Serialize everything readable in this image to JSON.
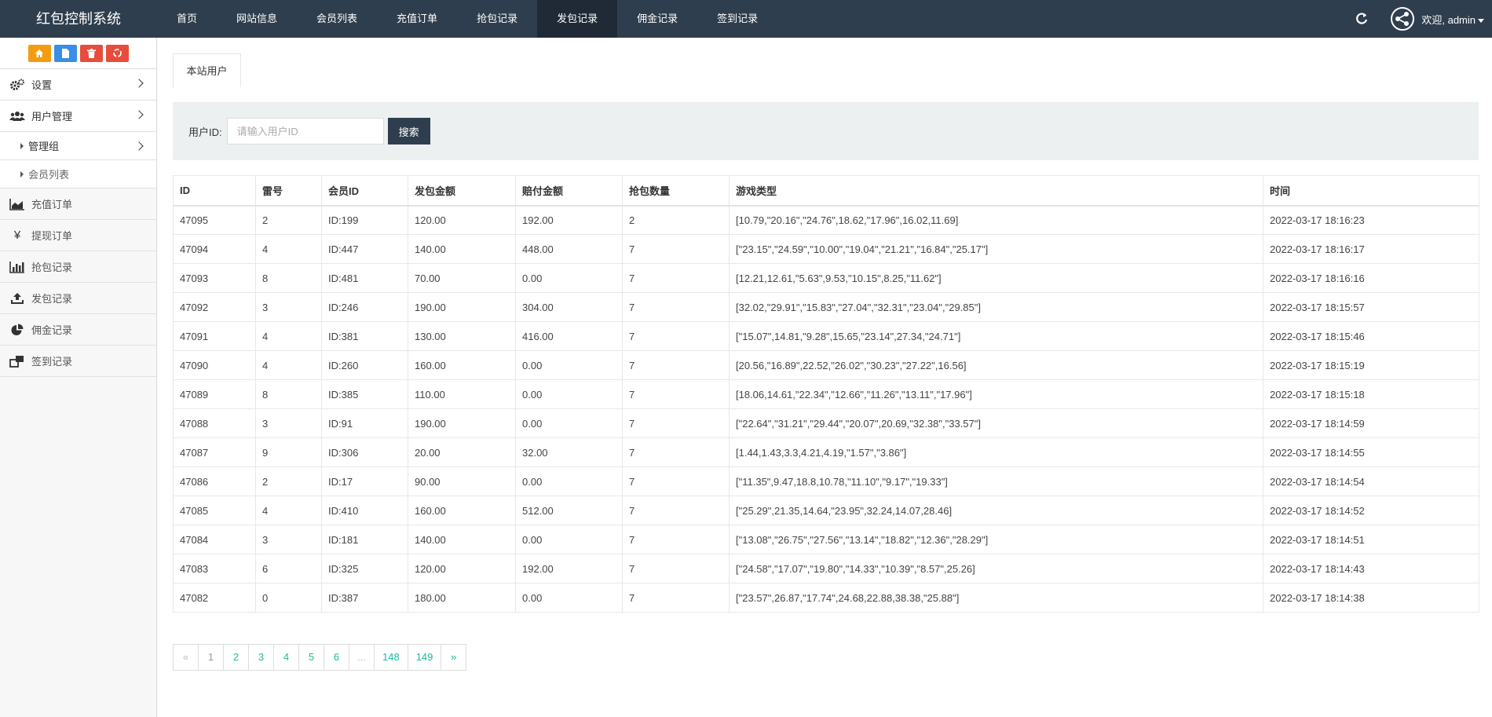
{
  "brand": "红包控制系统",
  "nav": [
    {
      "label": "首页",
      "active": false
    },
    {
      "label": "网站信息",
      "active": false
    },
    {
      "label": "会员列表",
      "active": false
    },
    {
      "label": "充值订单",
      "active": false
    },
    {
      "label": "抢包记录",
      "active": false
    },
    {
      "label": "发包记录",
      "active": true
    },
    {
      "label": "佣金记录",
      "active": false
    },
    {
      "label": "签到记录",
      "active": false
    }
  ],
  "user": {
    "welcome": "欢迎, admin"
  },
  "shortcuts": [
    "home-icon",
    "file-icon",
    "trash-icon",
    "recycle-icon"
  ],
  "sidebar": {
    "settings": "设置",
    "user_mgmt": "用户管理",
    "admin_group": "管理组",
    "member_list": "会员列表",
    "recharge": "充值订单",
    "withdraw": "提现订单",
    "grab": "抢包记录",
    "send": "发包记录",
    "commission": "佣金记录",
    "signin": "签到记录"
  },
  "tab": {
    "label": "本站用户"
  },
  "search": {
    "label": "用户ID:",
    "placeholder": "请输入用户ID",
    "button": "搜索"
  },
  "table": {
    "columns": [
      "ID",
      "雷号",
      "会员ID",
      "发包金额",
      "赔付金额",
      "抢包数量",
      "游戏类型",
      "时间"
    ],
    "rows": [
      [
        "47095",
        "2",
        "ID:199",
        "120.00",
        "192.00",
        "2",
        "[10.79,\"20.16\",\"24.76\",18.62,\"17.96\",16.02,11.69]",
        "2022-03-17 18:16:23"
      ],
      [
        "47094",
        "4",
        "ID:447",
        "140.00",
        "448.00",
        "7",
        "[\"23.15\",\"24.59\",\"10.00\",\"19.04\",\"21.21\",\"16.84\",\"25.17\"]",
        "2022-03-17 18:16:17"
      ],
      [
        "47093",
        "8",
        "ID:481",
        "70.00",
        "0.00",
        "7",
        "[12.21,12.61,\"5.63\",9.53,\"10.15\",8.25,\"11.62\"]",
        "2022-03-17 18:16:16"
      ],
      [
        "47092",
        "3",
        "ID:246",
        "190.00",
        "304.00",
        "7",
        "[32.02,\"29.91\",\"15.83\",\"27.04\",\"32.31\",\"23.04\",\"29.85\"]",
        "2022-03-17 18:15:57"
      ],
      [
        "47091",
        "4",
        "ID:381",
        "130.00",
        "416.00",
        "7",
        "[\"15.07\",14.81,\"9.28\",15.65,\"23.14\",27.34,\"24.71\"]",
        "2022-03-17 18:15:46"
      ],
      [
        "47090",
        "4",
        "ID:260",
        "160.00",
        "0.00",
        "7",
        "[20.56,\"16.89\",22.52,\"26.02\",\"30.23\",\"27.22\",16.56]",
        "2022-03-17 18:15:19"
      ],
      [
        "47089",
        "8",
        "ID:385",
        "110.00",
        "0.00",
        "7",
        "[18.06,14.61,\"22.34\",\"12.66\",\"11.26\",\"13.11\",\"17.96\"]",
        "2022-03-17 18:15:18"
      ],
      [
        "47088",
        "3",
        "ID:91",
        "190.00",
        "0.00",
        "7",
        "[\"22.64\",\"31.21\",\"29.44\",\"20.07\",20.69,\"32.38\",\"33.57\"]",
        "2022-03-17 18:14:59"
      ],
      [
        "47087",
        "9",
        "ID:306",
        "20.00",
        "32.00",
        "7",
        "[1.44,1.43,3.3,4.21,4.19,\"1.57\",\"3.86\"]",
        "2022-03-17 18:14:55"
      ],
      [
        "47086",
        "2",
        "ID:17",
        "90.00",
        "0.00",
        "7",
        "[\"11.35\",9.47,18.8,10.78,\"11.10\",\"9.17\",\"19.33\"]",
        "2022-03-17 18:14:54"
      ],
      [
        "47085",
        "4",
        "ID:410",
        "160.00",
        "512.00",
        "7",
        "[\"25.29\",21.35,14.64,\"23.95\",32.24,14.07,28.46]",
        "2022-03-17 18:14:52"
      ],
      [
        "47084",
        "3",
        "ID:181",
        "140.00",
        "0.00",
        "7",
        "[\"13.08\",\"26.75\",\"27.56\",\"13.14\",\"18.82\",\"12.36\",\"28.29\"]",
        "2022-03-17 18:14:51"
      ],
      [
        "47083",
        "6",
        "ID:325",
        "120.00",
        "192.00",
        "7",
        "[\"24.58\",\"17.07\",\"19.80\",\"14.33\",\"10.39\",\"8.57\",25.26]",
        "2022-03-17 18:14:43"
      ],
      [
        "47082",
        "0",
        "ID:387",
        "180.00",
        "0.00",
        "7",
        "[\"23.57\",26.87,\"17.74\",24.68,22.88,38.38,\"25.88\"]",
        "2022-03-17 18:14:38"
      ]
    ]
  },
  "pagination": {
    "items": [
      {
        "label": "«",
        "state": "disabled"
      },
      {
        "label": "1",
        "state": "current"
      },
      {
        "label": "2",
        "state": "link"
      },
      {
        "label": "3",
        "state": "link"
      },
      {
        "label": "4",
        "state": "link"
      },
      {
        "label": "5",
        "state": "link"
      },
      {
        "label": "6",
        "state": "link"
      },
      {
        "label": "...",
        "state": "disabled"
      },
      {
        "label": "148",
        "state": "link"
      },
      {
        "label": "149",
        "state": "link"
      },
      {
        "label": "»",
        "state": "link"
      }
    ]
  },
  "colors": {
    "topbar": "#2f3e4e",
    "active_nav": "#1f2a36",
    "link": "#1abc9c"
  }
}
